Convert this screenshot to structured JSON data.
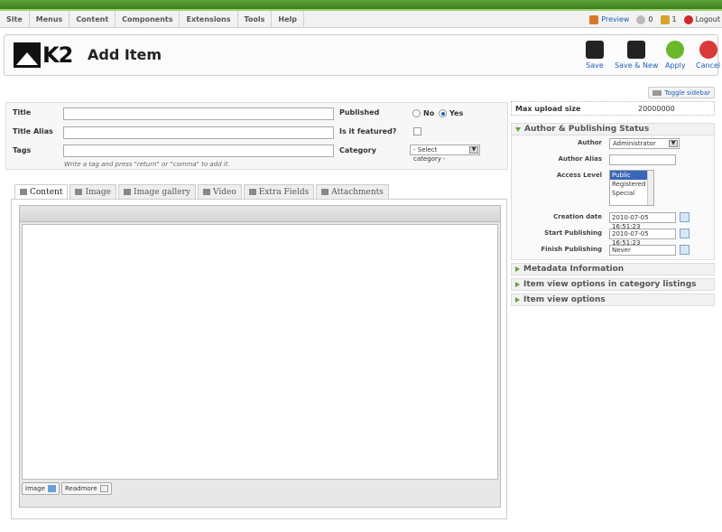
{
  "menu": [
    "Site",
    "Menus",
    "Content",
    "Components",
    "Extensions",
    "Tools",
    "Help"
  ],
  "status": {
    "preview": "Preview",
    "messages": "0",
    "users": "1",
    "logout": "Logout"
  },
  "header": {
    "logo_text": "K2",
    "title": "Add Item"
  },
  "toolbar": {
    "save": "Save",
    "save_new": "Save & New",
    "apply": "Apply",
    "cancel": "Cancel"
  },
  "sidebar_toggle": "Toggle sidebar",
  "form": {
    "title_label": "Title",
    "alias_label": "Title Alias",
    "tags_label": "Tags",
    "tags_hint": "Write a tag and press \"return\" or \"comma\" to add it.",
    "published_label": "Published",
    "published_no": "No",
    "published_yes": "Yes",
    "featured_label": "Is it featured?",
    "category_label": "Category",
    "category_value": "- Select category -"
  },
  "tabs": [
    "Content",
    "Image",
    "Image gallery",
    "Video",
    "Extra Fields",
    "Attachments"
  ],
  "editor": {
    "image_btn": "Image",
    "readmore_btn": "Readmore"
  },
  "side": {
    "max_upload_label": "Max upload size",
    "max_upload_value": "20000000",
    "author_panel": "Author & Publishing Status",
    "author_label": "Author",
    "author_value": "Administrator",
    "alias_label": "Author Alias",
    "access_label": "Access Level",
    "access_options": [
      "Public",
      "Registered",
      "Special"
    ],
    "created_label": "Creation date",
    "created_value": "2010-07-05 16:51:23",
    "start_label": "Start Publishing",
    "start_value": "2010-07-05 16:51:23",
    "finish_label": "Finish Publishing",
    "finish_value": "Never",
    "metadata_panel": "Metadata Information",
    "category_listing_panel": "Item view options in category listings",
    "item_view_panel": "Item view options"
  },
  "colors": {
    "accent_green": "#5fa33b",
    "link_blue": "#1d5fb8"
  }
}
